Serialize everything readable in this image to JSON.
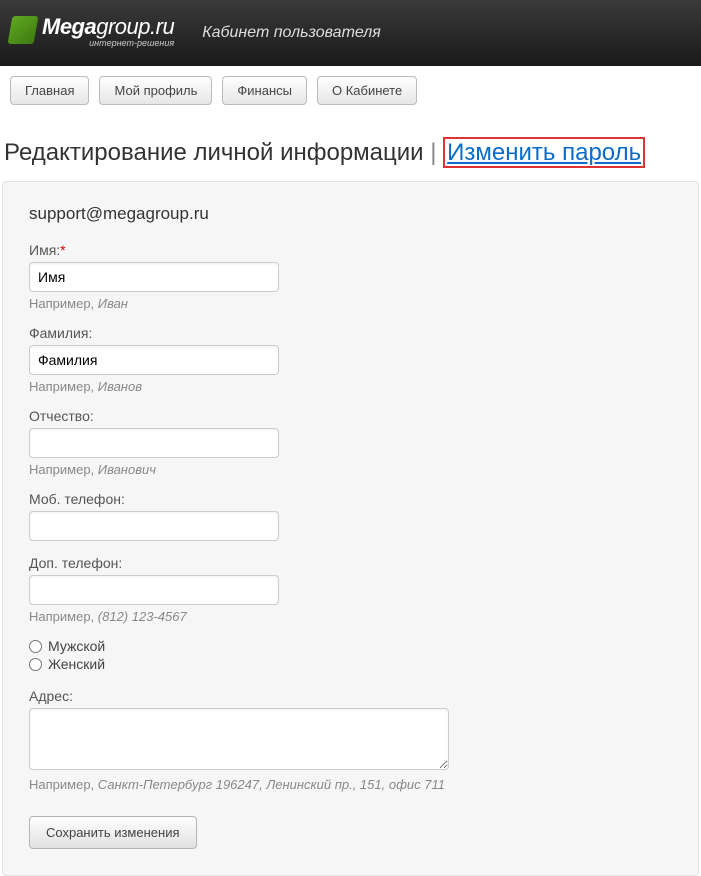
{
  "header": {
    "logo_main": "Mega",
    "logo_sub": "group.ru",
    "logo_tagline": "интернет-решения",
    "title": "Кабинет пользователя"
  },
  "toolbar": {
    "home": "Главная",
    "profile": "Мой профиль",
    "finance": "Финансы",
    "about": "О Кабинете"
  },
  "page": {
    "title": "Редактирование личной информации",
    "separator": "|",
    "change_password": "Изменить пароль"
  },
  "form": {
    "email": "support@megagroup.ru",
    "name_label": "Имя:",
    "name_value": "Имя",
    "name_hint_prefix": "Например, ",
    "name_hint_em": "Иван",
    "surname_label": "Фамилия:",
    "surname_value": "Фамилия",
    "surname_hint_prefix": "Например, ",
    "surname_hint_em": "Иванов",
    "patronymic_label": "Отчество:",
    "patronymic_value": "",
    "patronymic_hint_prefix": "Например, ",
    "patronymic_hint_em": "Иванович",
    "mobile_label": "Моб. телефон:",
    "mobile_value": "",
    "extra_phone_label": "Доп. телефон:",
    "extra_phone_value": "",
    "extra_phone_hint_prefix": "Например, ",
    "extra_phone_hint_em": "(812) 123-4567",
    "gender_male": "Мужской",
    "gender_female": "Женский",
    "address_label": "Адрес:",
    "address_value": "",
    "address_hint_prefix": "Например, ",
    "address_hint_em": "Санкт-Петербург 196247, Ленинский пр., 151, офис 711",
    "submit": "Сохранить изменения"
  }
}
